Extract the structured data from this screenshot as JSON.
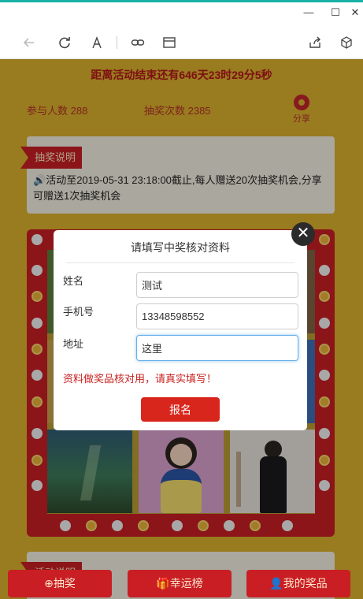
{
  "browser": {
    "minimize_glyph": "—",
    "maximize_glyph": "☐",
    "close_glyph": "✕"
  },
  "page": {
    "countdown": "距离活动结束还有646天23时29分5秒",
    "participants": "参与人数 288",
    "draws": "抽奖次数 2385",
    "share_label": "分享",
    "explain_badge": "抽奖说明",
    "explain_text": "活动至2019-05-31 23:18:00截止,每人赠送20次抽奖机会,分享可赠送1次抽奖机会",
    "bottom_badge": "活动说明"
  },
  "dialog": {
    "title": "请填写中奖核对资料",
    "name_label": "姓名",
    "name_value": "测试",
    "phone_label": "手机号",
    "phone_value": "13348598552",
    "address_label": "地址",
    "address_value": "这里",
    "warning": "资料做奖品核对用，请真实填写！",
    "submit_label": "报名",
    "close_glyph": "✕"
  },
  "nav": {
    "draw": "抽奖",
    "lucky": "幸运榜",
    "my_prizes": "我的奖品"
  },
  "colors": {
    "page_bg": "#dcb12f",
    "accent_red": "#c91f24",
    "submit_red": "#d9261c"
  }
}
